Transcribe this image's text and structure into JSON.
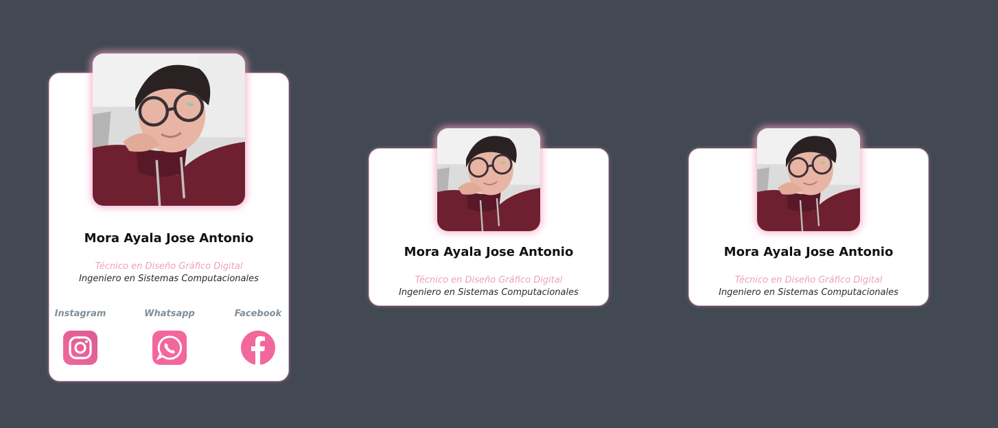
{
  "colors": {
    "background": "#424953",
    "card": "#ffffff",
    "accent_pink": "#f2679c",
    "subtitle_pink": "#ee9fbf",
    "social_label": "#7f9099"
  },
  "cards": [
    {
      "name": "Mora Ayala Jose Antonio",
      "title_primary": "Técnico en Diseño Gráfico Digital",
      "title_secondary": "Ingeniero en Sistemas Computacionales",
      "photo_icon": "profile-photo",
      "social": [
        {
          "label": "Instagram",
          "icon": "instagram-icon"
        },
        {
          "label": "Whatsapp",
          "icon": "whatsapp-icon"
        },
        {
          "label": "Facebook",
          "icon": "facebook-icon"
        }
      ]
    },
    {
      "name": "Mora Ayala Jose Antonio",
      "title_primary": "Técnico en Diseño Gráfico Digital",
      "title_secondary": "Ingeniero en Sistemas Computacionales",
      "photo_icon": "profile-photo"
    },
    {
      "name": "Mora Ayala Jose Antonio",
      "title_primary": "Técnico en Diseño Gráfico Digital",
      "title_secondary": "Ingeniero en Sistemas Computacionales",
      "photo_icon": "profile-photo"
    }
  ]
}
